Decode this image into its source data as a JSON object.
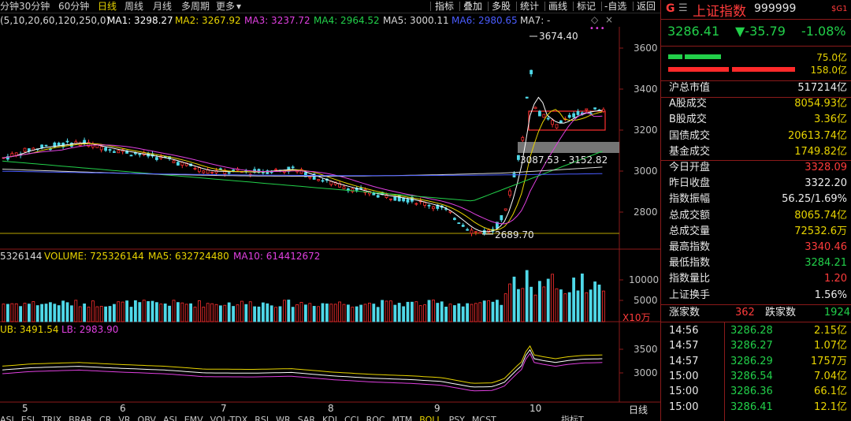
{
  "toolbar": {
    "periods": [
      "分钟",
      "30分钟",
      "60分钟",
      "日线",
      "周线",
      "月线",
      "多周期",
      "更多"
    ],
    "active_period": "日线",
    "tools": [
      "指标",
      "叠加",
      "多股",
      "统计",
      "画线",
      "标记",
      "-自选",
      "返回"
    ]
  },
  "chart": {
    "ma_params": "(5,10,20,60,120,250,0)",
    "ma": [
      {
        "label": "MA1: 3298.27",
        "color": "#ffffff"
      },
      {
        "label": "MA2: 3267.92",
        "color": "#e8d400"
      },
      {
        "label": "MA3: 3237.72",
        "color": "#e040e0"
      },
      {
        "label": "MA4: 2964.52",
        "color": "#22d04a"
      },
      {
        "label": "MA5: 3000.11",
        "color": "#d8d8d8"
      },
      {
        "label": "MA6: 2980.65",
        "color": "#4a5cff"
      },
      {
        "label": "MA7: -",
        "color": "#d8d8d8"
      }
    ],
    "price_ticks": [
      "3600",
      "3400",
      "3200",
      "3000",
      "2800"
    ],
    "annot_high": "3674.40",
    "annot_low": "2689.70",
    "annot_range": "3087.53 - 3152.82",
    "volume_legend": {
      "prefix": "5326144",
      "volume": "VOLUME: 725326144",
      "ma5": "MA5: 632724480",
      "ma10": "MA10: 614412672"
    },
    "volume_ticks": [
      "10000",
      "5000"
    ],
    "volume_unit": "X10万",
    "boll_legend": {
      "ub": "UB: 3491.54",
      "lb": "LB: 2983.90"
    },
    "boll_ticks": [
      "3500",
      "3000"
    ],
    "x_ticks": [
      "5",
      "6",
      "7",
      "8",
      "9",
      "10"
    ],
    "bottom_label": "日线",
    "indicator_tabs": [
      "ASI",
      "ESI",
      "TRIX",
      "BRAR",
      "CR",
      "VR",
      "OBV",
      "ASI",
      "EMV",
      "VOL-TDX",
      "RSI",
      "WR",
      "SAR",
      "KDJ",
      "CCI",
      "ROC",
      "MTM",
      "BOLL",
      "PSY",
      "MCST"
    ],
    "active_indicator": "BOLL",
    "indicator_right": "指标T"
  },
  "quote": {
    "code_prefix": "G",
    "name": "上证指数",
    "code": "999999",
    "badge": "$G1",
    "price": "3286.41",
    "change": "▼-35.79",
    "change_pct": "-1.08%",
    "buy_vol": "75.0亿",
    "sell_vol": "158.0亿",
    "rows": [
      {
        "label": "沪总市值",
        "value": "517214亿",
        "color": "white"
      },
      {
        "label": "A股成交",
        "value": "8054.93亿",
        "color": "yellow"
      },
      {
        "label": "B股成交",
        "value": "3.36亿",
        "color": "yellow"
      },
      {
        "label": "国债成交",
        "value": "20613.74亿",
        "color": "yellow"
      },
      {
        "label": "基金成交",
        "value": "1749.82亿",
        "color": "yellow"
      },
      {
        "label": "今日开盘",
        "value": "3328.09",
        "color": "red"
      },
      {
        "label": "昨日收盘",
        "value": "3322.20",
        "color": "white"
      },
      {
        "label": "指数振幅",
        "value": "56.25/1.69%",
        "color": "white"
      },
      {
        "label": "总成交额",
        "value": "8065.74亿",
        "color": "yellow"
      },
      {
        "label": "总成交量",
        "value": "72532.6万",
        "color": "yellow"
      },
      {
        "label": "最高指数",
        "value": "3340.46",
        "color": "red"
      },
      {
        "label": "最低指数",
        "value": "3284.21",
        "color": "green"
      },
      {
        "label": "指数量比",
        "value": "1.20",
        "color": "red"
      },
      {
        "label": "上证换手",
        "value": "1.56%",
        "color": "white"
      }
    ],
    "up_label": "涨家数",
    "up_count": "362",
    "down_label": "跌家数",
    "down_count": "1924",
    "ticks": [
      {
        "time": "14:56",
        "price": "3286.28",
        "vol": "2.15亿"
      },
      {
        "time": "14:57",
        "price": "3286.27",
        "vol": "1.07亿"
      },
      {
        "time": "14:57",
        "price": "3286.29",
        "vol": "1757万"
      },
      {
        "time": "15:00",
        "price": "3286.54",
        "vol": "7.04亿"
      },
      {
        "time": "15:00",
        "price": "3286.36",
        "vol": "66.1亿"
      },
      {
        "time": "15:00",
        "price": "3286.41",
        "vol": "12.1亿"
      }
    ]
  }
}
